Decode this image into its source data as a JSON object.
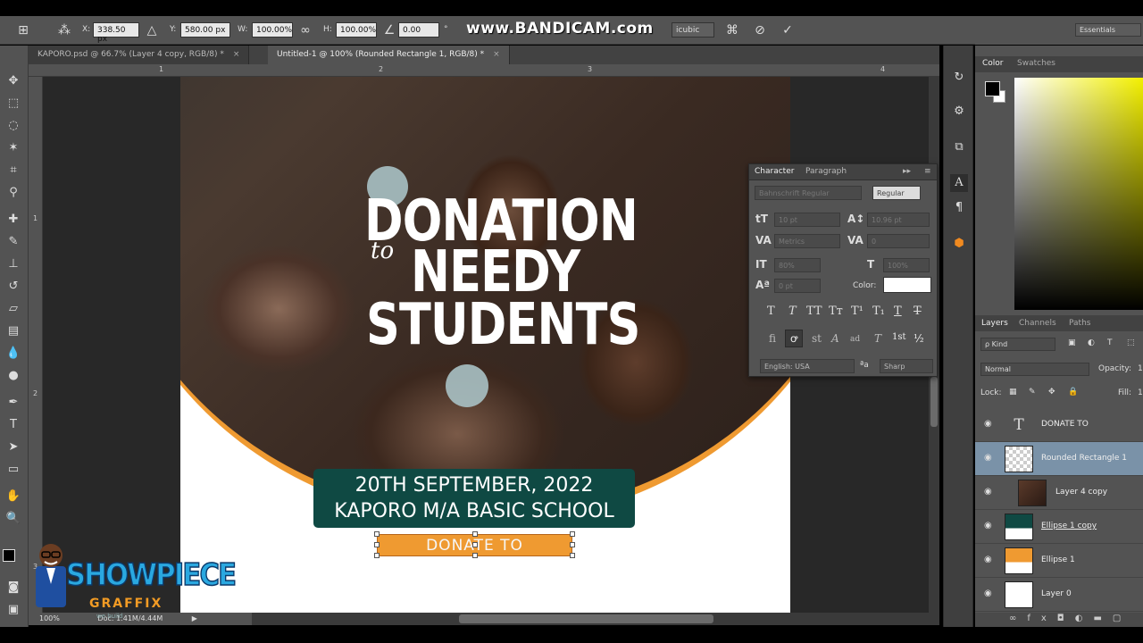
{
  "options_bar": {
    "x_label": "X:",
    "x_value": "338.50 px",
    "y_label": "Y:",
    "y_value": "580.00 px",
    "w_label": "W:",
    "w_value": "100.00%",
    "h_label": "H:",
    "h_value": "100.00%",
    "angle_value": "0.00",
    "angle_unit": "°",
    "interp_value": "icubic",
    "watermark": "www.BANDICAM.com",
    "workspace": "Essentials"
  },
  "tabs": [
    {
      "label": "KAPORO.psd @ 66.7% (Layer 4 copy, RGB/8) *",
      "active": false
    },
    {
      "label": "Untitled-1 @ 100% (Rounded Rectangle 1, RGB/8) *",
      "active": true
    }
  ],
  "ruler": {
    "h": [
      "1",
      "2",
      "3",
      "4"
    ],
    "v": [
      "1",
      "2",
      "3"
    ]
  },
  "design": {
    "title_line1": "DONATION",
    "title_script": "to",
    "title_line2": "NEEDY",
    "title_line3": "STUDENTS",
    "date_line": "20TH SEPTEMBER, 2022",
    "school_line": "KAPORO M/A BASIC SCHOOL",
    "button_text": "DONATE TO",
    "accent_color": "#ef9a31",
    "box_color": "#0f4943"
  },
  "status": {
    "zoom": "100%",
    "doc": "Doc: 1.41M/4.44M"
  },
  "character_panel": {
    "tab_character": "Character",
    "tab_paragraph": "Paragraph",
    "font_family": "Bahnschrift Regular",
    "font_style": "Regular",
    "font_size": "10 pt",
    "leading": "10.96 pt",
    "kerning": "Metrics",
    "tracking": "0",
    "vscale": "80%",
    "hscale": "100%",
    "baseline": "0 pt",
    "color_label": "Color:",
    "language": "English: USA",
    "aa_label": "ªa",
    "antialias": "Sharp",
    "style_buttons": [
      "T",
      "T",
      "TT",
      "Tт",
      "T¹",
      "T₁",
      "T",
      "T"
    ],
    "ot_buttons": [
      "fi",
      "ꝍ",
      "st",
      "A",
      "ad",
      "T",
      "1st",
      "½"
    ]
  },
  "color_panel": {
    "tab_color": "Color",
    "tab_swatches": "Swatches"
  },
  "layers_panel": {
    "tab_layers": "Layers",
    "tab_channels": "Channels",
    "tab_paths": "Paths",
    "filter": "ρ Kind",
    "blend": "Normal",
    "opacity_label": "Opacity:",
    "opacity_value": "1",
    "lock_label": "Lock:",
    "fill_label": "Fill:",
    "fill_value": "1",
    "layers": [
      {
        "name": "DONATE TO",
        "type": "text"
      },
      {
        "name": "Rounded Rectangle 1",
        "type": "shape",
        "selected": true
      },
      {
        "name": "Layer 4 copy",
        "type": "image"
      },
      {
        "name": "Ellipse 1 copy",
        "type": "shape-teal"
      },
      {
        "name": "Ellipse 1",
        "type": "shape-orange"
      },
      {
        "name": "Layer 0",
        "type": "white"
      }
    ]
  },
  "logo": {
    "brand": "SHOWPIECE",
    "sub": "GRAFFIX",
    "tagline": "we build"
  }
}
